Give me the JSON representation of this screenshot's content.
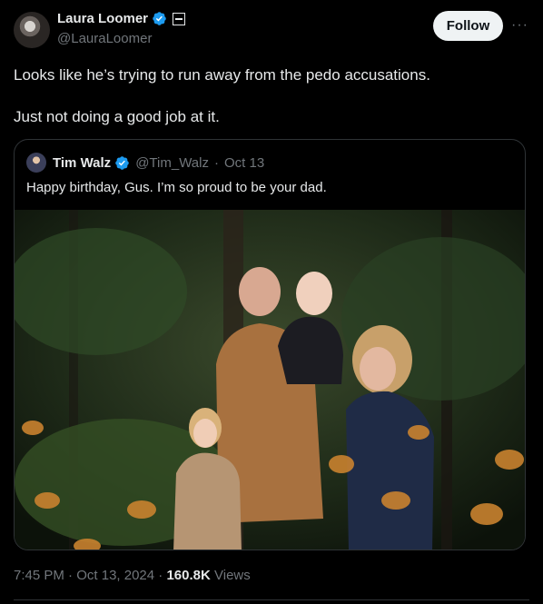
{
  "author": {
    "display_name": "Laura Loomer",
    "handle": "@LauraLoomer",
    "follow_label": "Follow",
    "more_label": "···"
  },
  "tweet": {
    "text": "Looks like he’s trying to run away from the pedo accusations.\n\nJust not doing a good job at it."
  },
  "quoted": {
    "display_name": "Tim Walz",
    "handle": "@Tim_Walz",
    "separator": "·",
    "date": "Oct 13",
    "text": "Happy birthday, Gus. I’m so proud to be your dad."
  },
  "meta": {
    "time": "7:45 PM",
    "separator": "·",
    "date": "Oct 13, 2024",
    "views_count": "160.8K",
    "views_label": "Views"
  },
  "colors": {
    "background": "#000000",
    "text_primary": "#e7e9ea",
    "text_secondary": "#71767b",
    "verified_blue": "#1d9bf0",
    "border": "#2f3336"
  },
  "icons": [
    "verified-badge-icon",
    "affiliation-badge-icon",
    "more-options-icon"
  ]
}
